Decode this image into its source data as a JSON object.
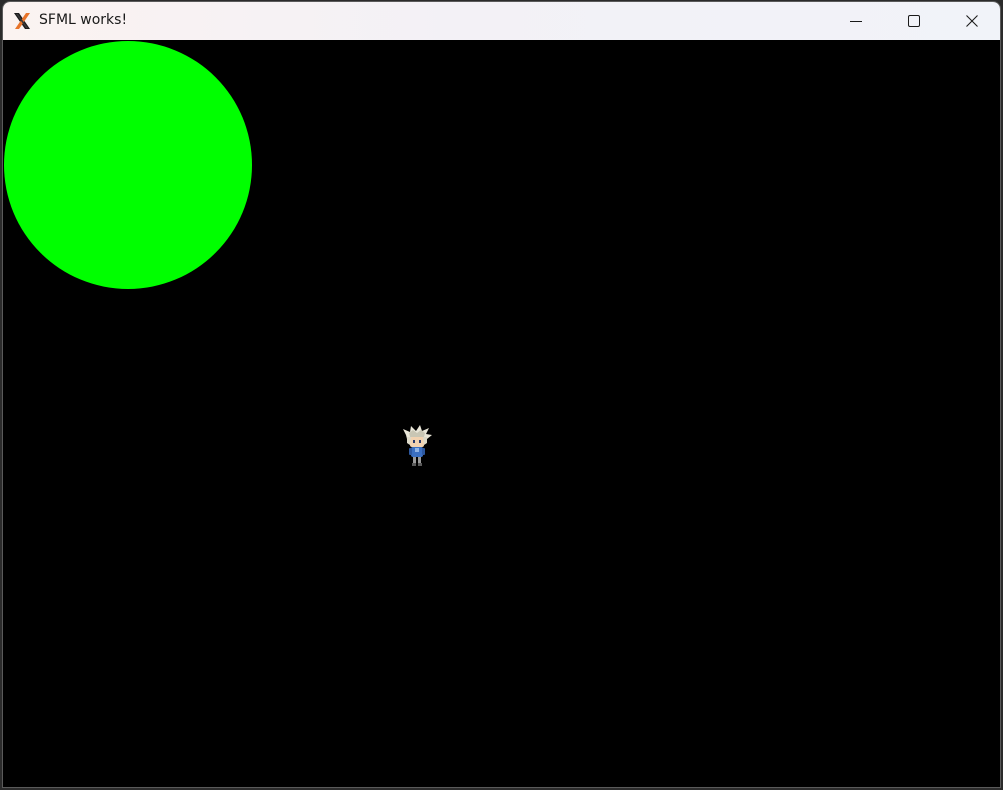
{
  "window": {
    "title": "SFML works!",
    "app_icon": "x-logo-icon",
    "controls": {
      "minimize": "minimize-icon",
      "maximize": "maximize-icon",
      "close": "close-icon"
    }
  },
  "scene": {
    "background_color": "#000000",
    "shapes": [
      {
        "kind": "circle",
        "color": "#00ff00"
      }
    ],
    "sprites": [
      {
        "kind": "character-sprite",
        "description_icon": "player-character-icon"
      }
    ]
  }
}
